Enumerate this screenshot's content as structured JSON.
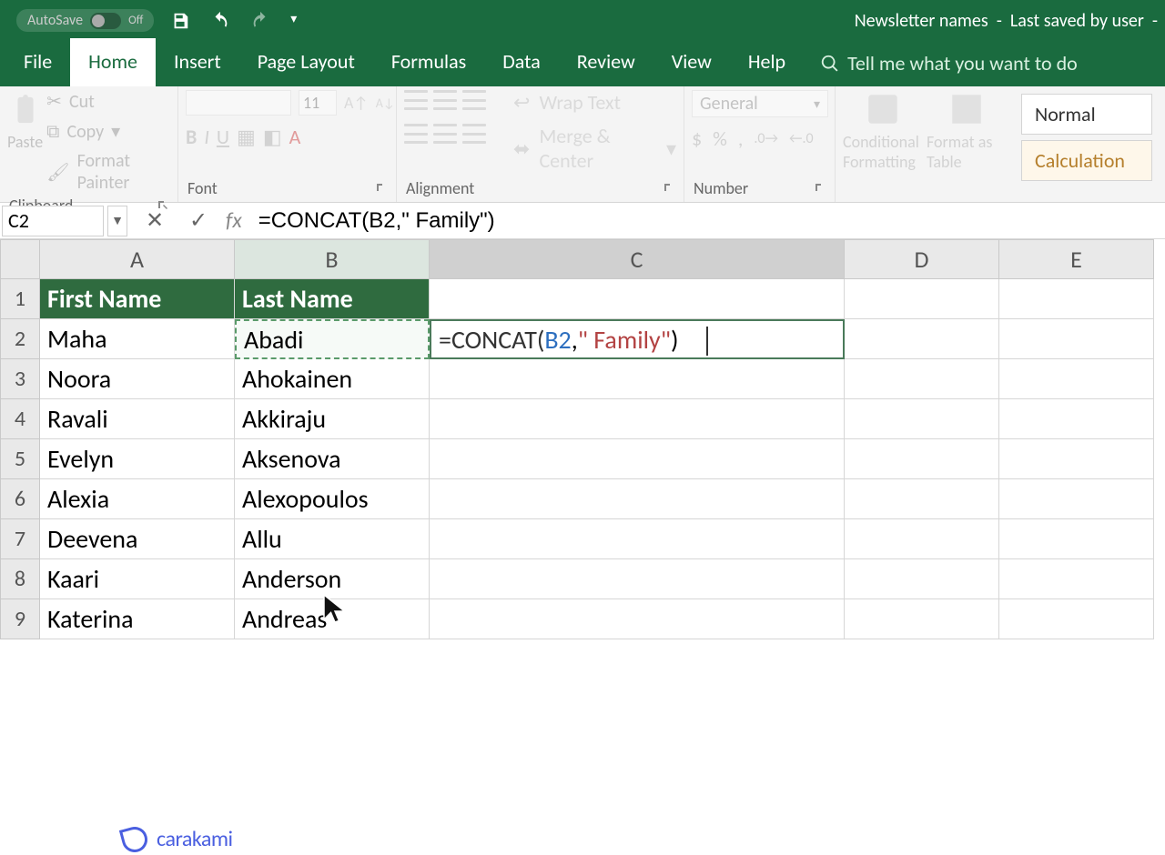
{
  "title": {
    "doc": "Newsletter names",
    "save": "Last saved by user",
    "autosave": "AutoSave",
    "autosave_state": "Off"
  },
  "tabs": {
    "file": "File",
    "home": "Home",
    "insert": "Insert",
    "page": "Page Layout",
    "formulas": "Formulas",
    "data": "Data",
    "review": "Review",
    "view": "View",
    "help": "Help",
    "tellme": "Tell me what you want to do"
  },
  "ribbon": {
    "clipboard": {
      "label": "Clipboard",
      "paste": "Paste",
      "cut": "Cut",
      "copy": "Copy",
      "painter": "Format Painter"
    },
    "font": {
      "label": "Font",
      "size": "11"
    },
    "alignment": {
      "label": "Alignment",
      "wrap": "Wrap Text",
      "merge": "Merge & Center"
    },
    "number": {
      "label": "Number",
      "format": "General"
    },
    "styles": {
      "cond": "Conditional Formatting",
      "table": "Format as Table",
      "normal": "Normal",
      "calc": "Calculation"
    }
  },
  "fxbar": {
    "namebox": "C2",
    "formula": "=CONCAT(B2,\" Family\")"
  },
  "cols": [
    "A",
    "B",
    "C",
    "D",
    "E"
  ],
  "headers": {
    "a": "First Name",
    "b": "Last Name"
  },
  "rows": [
    {
      "n": "1"
    },
    {
      "n": "2",
      "a": "Maha",
      "b": "Abadi"
    },
    {
      "n": "3",
      "a": "Noora",
      "b": "Ahokainen"
    },
    {
      "n": "4",
      "a": "Ravali",
      "b": "Akkiraju"
    },
    {
      "n": "5",
      "a": "Evelyn",
      "b": "Aksenova"
    },
    {
      "n": "6",
      "a": "Alexia",
      "b": "Alexopoulos"
    },
    {
      "n": "7",
      "a": "Deevena",
      "b": "Allu"
    },
    {
      "n": "8",
      "a": "Kaari",
      "b": "Anderson"
    },
    {
      "n": "9",
      "a": "Katerina",
      "b": "Andreas"
    }
  ],
  "editcell": {
    "eq": "=",
    "fn": "CONCAT(",
    "ref": "B2",
    "comma": ",",
    "str": "\" Family\"",
    "close": ")"
  },
  "watermark": "carakami"
}
